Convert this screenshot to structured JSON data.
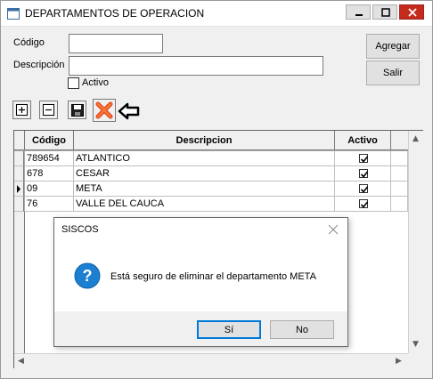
{
  "window": {
    "title": "DEPARTAMENTOS DE OPERACION",
    "controls": {
      "minimize_icon": "minimize-icon",
      "maximize_icon": "maximize-icon",
      "close_icon": "close-icon"
    }
  },
  "form": {
    "codigo_label": "Código",
    "codigo_value": "",
    "descripcion_label": "Descripción",
    "descripcion_value": "",
    "activo_label": "Activo",
    "activo_checked": false
  },
  "buttons": {
    "agregar": "Agregar",
    "salir": "Salir"
  },
  "toolbar": {
    "items": [
      "add-row-icon",
      "remove-row-icon",
      "save-icon",
      "delete-icon",
      "arrow-left-icon"
    ]
  },
  "grid": {
    "columns": [
      "Código",
      "Descripcion",
      "Activo"
    ],
    "rows": [
      {
        "codigo": "789654",
        "descripcion": "ATLANTICO",
        "activo": true
      },
      {
        "codigo": "678",
        "descripcion": "CESAR",
        "activo": true
      },
      {
        "codigo": "09",
        "descripcion": "META",
        "activo": true,
        "current": true
      },
      {
        "codigo": "76",
        "descripcion": "VALLE DEL CAUCA",
        "activo": true
      }
    ]
  },
  "dialog": {
    "title": "SISCOS",
    "message": "Está seguro de eliminar el departamento META",
    "icon": "question-icon",
    "yes_label": "Sí",
    "no_label": "No"
  },
  "colors": {
    "accent": "#0078d7",
    "close_button": "#c42b1c",
    "delete_icon": "#e8481f",
    "question_icon": "#1c7fd1"
  }
}
